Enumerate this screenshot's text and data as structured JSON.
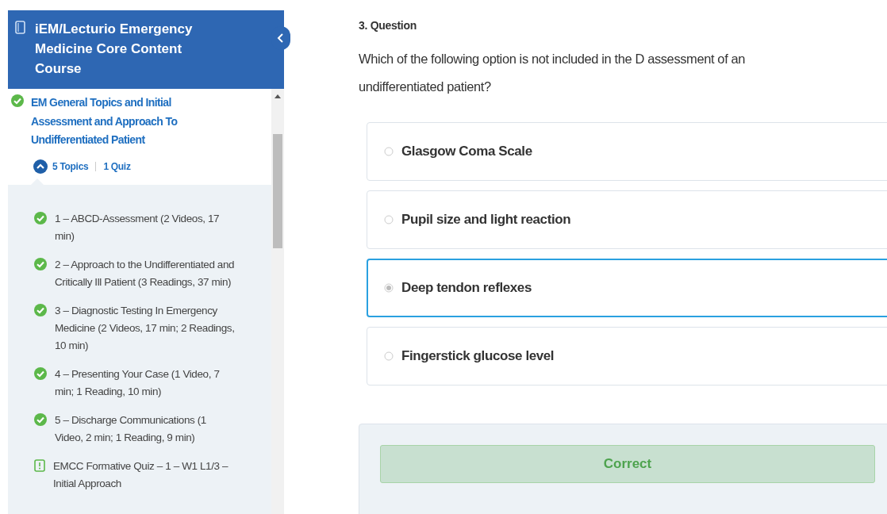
{
  "course": {
    "title": "iEM/Lecturio Emergency Medicine Core Content Course"
  },
  "section": {
    "title": "EM General Topics and Initial Assessment and Approach To Undifferentiated Patient",
    "completed": true,
    "expanded": true,
    "topics": "5 Topics",
    "quizzes": "1 Quiz"
  },
  "lessons": [
    {
      "kind": "topic",
      "completed": true,
      "title": "1 – ABCD-Assessment (2 Videos, 17 min)"
    },
    {
      "kind": "topic",
      "completed": true,
      "title": "2 – Approach to the Undifferentiated and Critically Ill Patient (3 Readings, 37 min)"
    },
    {
      "kind": "topic",
      "completed": true,
      "title": "3 – Diagnostic Testing In Emergency Medicine (2 Videos, 17 min; 2 Readings, 10 min)"
    },
    {
      "kind": "topic",
      "completed": true,
      "title": "4 – Presenting Your Case (1 Video, 7 min; 1 Reading, 10 min)"
    },
    {
      "kind": "topic",
      "completed": true,
      "title": "5 – Discharge Communications (1 Video, 2 min; 1 Reading, 9 min)"
    },
    {
      "kind": "quiz",
      "completed": false,
      "title": "EMCC Formative Quiz – 1 – W1 L1/3 – Initial Approach"
    }
  ],
  "question": {
    "heading": "3. Question",
    "text": "Which of the following option is not included in the D assessment of an undifferentiated patient?",
    "options": [
      {
        "label": "Glasgow Coma Scale",
        "selected": false
      },
      {
        "label": "Pupil size and light reaction",
        "selected": false
      },
      {
        "label": "Deep tendon reflexes",
        "selected": true
      },
      {
        "label": "Fingerstick glucose level",
        "selected": false
      }
    ]
  },
  "feedback": {
    "correct": true,
    "label": "Correct"
  }
}
